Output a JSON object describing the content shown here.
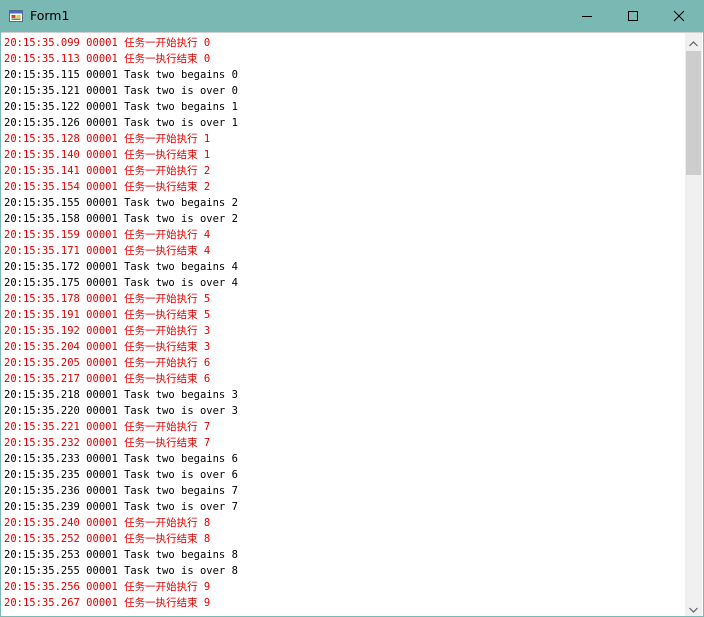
{
  "window": {
    "title": "Form1"
  },
  "colors": {
    "task_one": "#e00000",
    "task_two": "#000000",
    "titlebar": "#7ab8b3"
  },
  "icons": {
    "app": "form-app-icon",
    "minimize": "minimize-icon",
    "maximize": "maximize-icon",
    "close": "close-icon",
    "scroll_up": "chevron-up-icon",
    "scroll_down": "chevron-down-icon"
  },
  "log": [
    {
      "text": "20:15:35.099 00001 任务一开始执行 0",
      "color": "red"
    },
    {
      "text": "20:15:35.113 00001 任务一执行结束 0",
      "color": "red"
    },
    {
      "text": "20:15:35.115 00001 Task two begains 0",
      "color": "black"
    },
    {
      "text": "20:15:35.121 00001 Task two is over 0",
      "color": "black"
    },
    {
      "text": "20:15:35.122 00001 Task two begains 1",
      "color": "black"
    },
    {
      "text": "20:15:35.126 00001 Task two is over 1",
      "color": "black"
    },
    {
      "text": "20:15:35.128 00001 任务一开始执行 1",
      "color": "red"
    },
    {
      "text": "20:15:35.140 00001 任务一执行结束 1",
      "color": "red"
    },
    {
      "text": "20:15:35.141 00001 任务一开始执行 2",
      "color": "red"
    },
    {
      "text": "20:15:35.154 00001 任务一执行结束 2",
      "color": "red"
    },
    {
      "text": "20:15:35.155 00001 Task two begains 2",
      "color": "black"
    },
    {
      "text": "20:15:35.158 00001 Task two is over 2",
      "color": "black"
    },
    {
      "text": "20:15:35.159 00001 任务一开始执行 4",
      "color": "red"
    },
    {
      "text": "20:15:35.171 00001 任务一执行结束 4",
      "color": "red"
    },
    {
      "text": "20:15:35.172 00001 Task two begains 4",
      "color": "black"
    },
    {
      "text": "20:15:35.175 00001 Task two is over 4",
      "color": "black"
    },
    {
      "text": "20:15:35.178 00001 任务一开始执行 5",
      "color": "red"
    },
    {
      "text": "20:15:35.191 00001 任务一执行结束 5",
      "color": "red"
    },
    {
      "text": "20:15:35.192 00001 任务一开始执行 3",
      "color": "red"
    },
    {
      "text": "20:15:35.204 00001 任务一执行结束 3",
      "color": "red"
    },
    {
      "text": "20:15:35.205 00001 任务一开始执行 6",
      "color": "red"
    },
    {
      "text": "20:15:35.217 00001 任务一执行结束 6",
      "color": "red"
    },
    {
      "text": "20:15:35.218 00001 Task two begains 3",
      "color": "black"
    },
    {
      "text": "20:15:35.220 00001 Task two is over 3",
      "color": "black"
    },
    {
      "text": "20:15:35.221 00001 任务一开始执行 7",
      "color": "red"
    },
    {
      "text": "20:15:35.232 00001 任务一执行结束 7",
      "color": "red"
    },
    {
      "text": "20:15:35.233 00001 Task two begains 6",
      "color": "black"
    },
    {
      "text": "20:15:35.235 00001 Task two is over 6",
      "color": "black"
    },
    {
      "text": "20:15:35.236 00001 Task two begains 7",
      "color": "black"
    },
    {
      "text": "20:15:35.239 00001 Task two is over 7",
      "color": "black"
    },
    {
      "text": "20:15:35.240 00001 任务一开始执行 8",
      "color": "red"
    },
    {
      "text": "20:15:35.252 00001 任务一执行结束 8",
      "color": "red"
    },
    {
      "text": "20:15:35.253 00001 Task two begains 8",
      "color": "black"
    },
    {
      "text": "20:15:35.255 00001 Task two is over 8",
      "color": "black"
    },
    {
      "text": "20:15:35.256 00001 任务一开始执行 9",
      "color": "red"
    },
    {
      "text": "20:15:35.267 00001 任务一执行结束 9",
      "color": "red"
    }
  ]
}
